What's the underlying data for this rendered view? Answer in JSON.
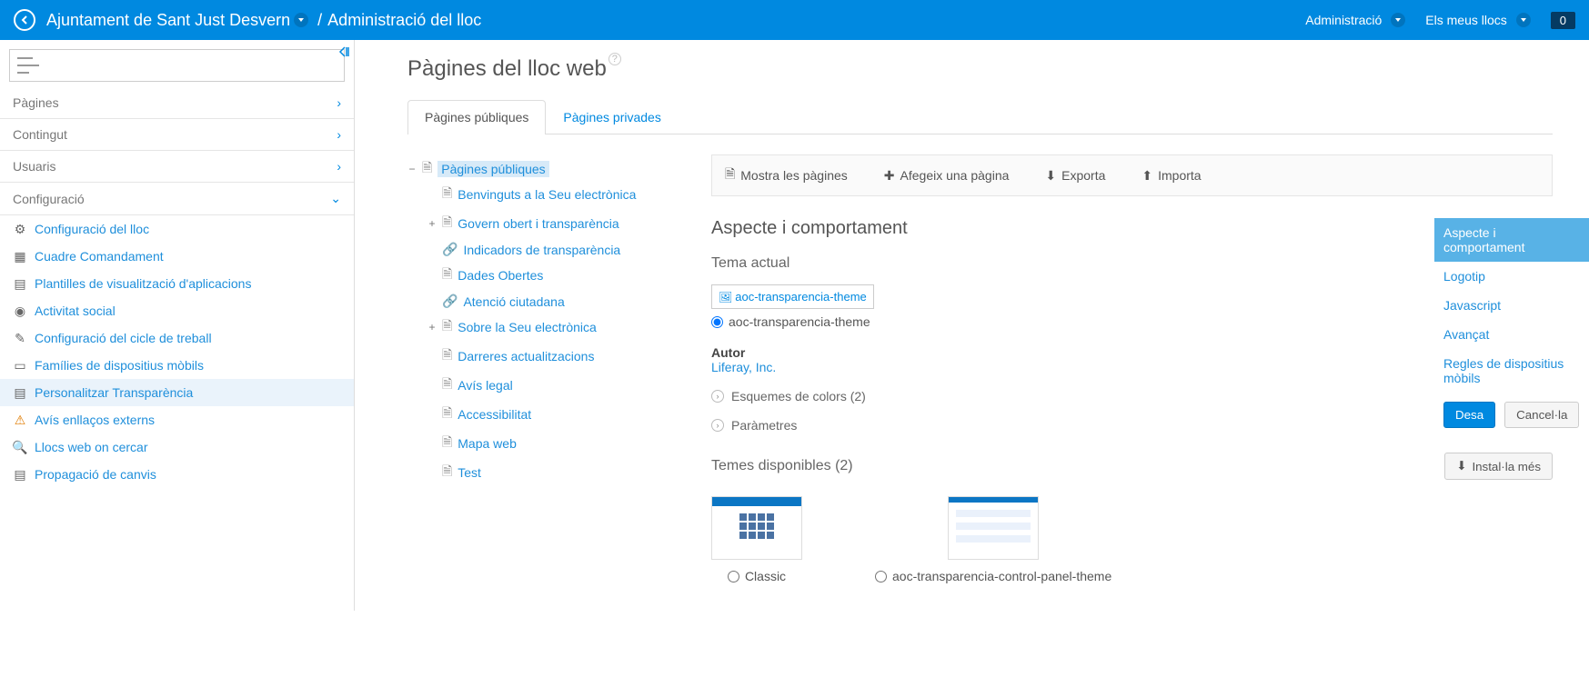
{
  "topbar": {
    "site_name": "Ajuntament de Sant Just Desvern",
    "crumb": "Administració del lloc",
    "admin_label": "Administració",
    "mysites_label": "Els meus llocs",
    "badge": "0"
  },
  "sidebar": {
    "cats": {
      "pages": "Pàgines",
      "content": "Contingut",
      "users": "Usuaris",
      "config": "Configuració"
    },
    "config_items": [
      "Configuració del lloc",
      "Cuadre Comandament",
      "Plantilles de visualització d'aplicacions",
      "Activitat social",
      "Configuració del cicle de treball",
      "Famílies de dispositius mòbils",
      "Personalitzar Transparència",
      "Avís enllaços externs",
      "Llocs web on cercar",
      "Propagació de canvis"
    ]
  },
  "main": {
    "title": "Pàgines del lloc web",
    "tabs": {
      "public": "Pàgines públiques",
      "private": "Pàgines privades"
    },
    "tree": {
      "root": "Pàgines públiques",
      "items": [
        {
          "label": "Benvinguts a la Seu electrònica",
          "icon": "page"
        },
        {
          "label": "Govern obert i transparència",
          "icon": "page",
          "expandable": true
        },
        {
          "label": "Indicadors de transparència",
          "icon": "link"
        },
        {
          "label": "Dades Obertes",
          "icon": "page"
        },
        {
          "label": "Atenció ciutadana",
          "icon": "link"
        },
        {
          "label": "Sobre la Seu electrònica",
          "icon": "page",
          "expandable": true
        },
        {
          "label": "Darreres actualitzacions",
          "icon": "page"
        },
        {
          "label": "Avís legal",
          "icon": "page"
        },
        {
          "label": "Accessibilitat",
          "icon": "page"
        },
        {
          "label": "Mapa web",
          "icon": "page"
        },
        {
          "label": "Test",
          "icon": "page"
        }
      ]
    },
    "toolbar": {
      "show": "Mostra les pàgines",
      "add": "Afegeix una pàgina",
      "export": "Exporta",
      "import": "Importa"
    },
    "sect_title": "Aspecte i comportament",
    "theme": {
      "current_label": "Tema actual",
      "thumb_alt": "aoc-transparencia-theme",
      "name": "aoc-transparencia-theme",
      "author_label": "Autor",
      "author": "Liferay, Inc.",
      "schemes": "Esquemes de colors (2)",
      "params": "Paràmetres"
    },
    "avail": {
      "title": "Temes disponibles (2)",
      "install": "Instal·la més",
      "t1": "Classic",
      "t2": "aoc-transparencia-control-panel-theme"
    }
  },
  "rightpanel": {
    "items": [
      "Aspecte i comportament",
      "Logotip",
      "Javascript",
      "Avançat",
      "Regles de dispositius mòbils"
    ],
    "save": "Desa",
    "cancel": "Cancel·la"
  }
}
